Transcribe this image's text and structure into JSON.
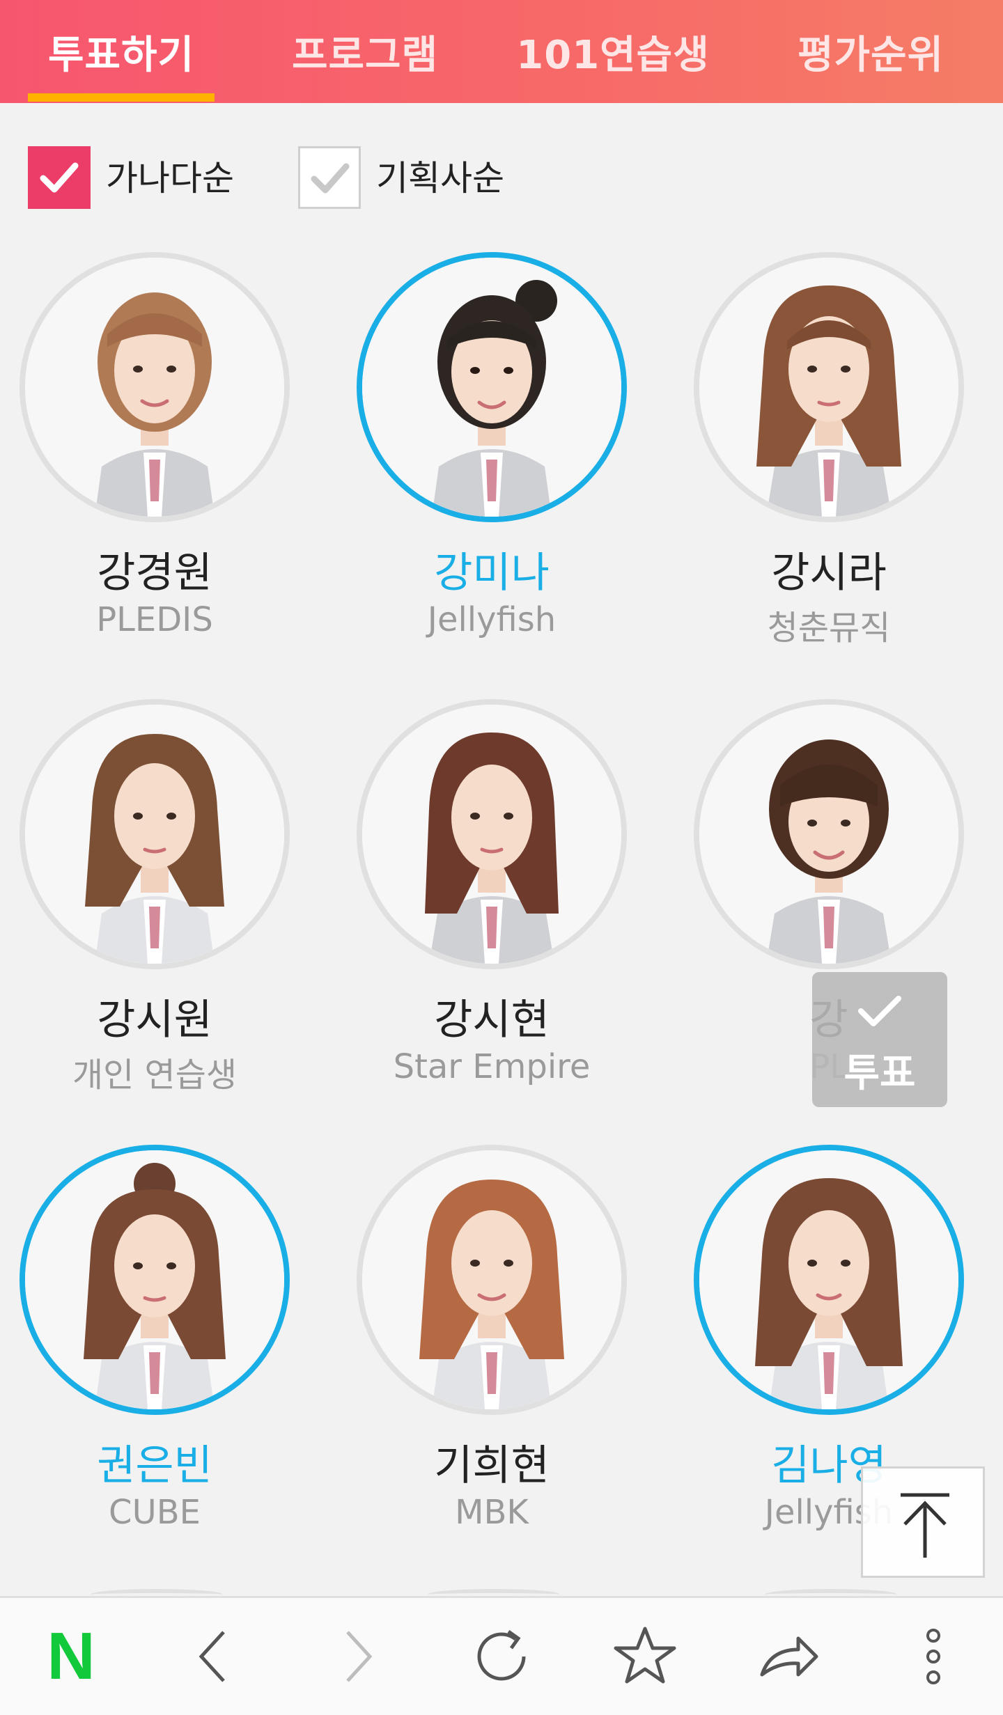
{
  "tabs": [
    {
      "label": "투표하기",
      "active": true
    },
    {
      "label": "프로그램",
      "active": false
    },
    {
      "label": "101연습생",
      "active": false
    },
    {
      "label": "평가순위",
      "active": false
    }
  ],
  "sort": [
    {
      "label": "가나다순",
      "checked": true
    },
    {
      "label": "기획사순",
      "checked": false
    }
  ],
  "trainees": [
    {
      "name": "강경원",
      "agency": "PLEDIS",
      "selected": false
    },
    {
      "name": "강미나",
      "agency": "Jellyfish",
      "selected": true
    },
    {
      "name": "강시라",
      "agency": "청춘뮤직",
      "selected": false
    },
    {
      "name": "강시원",
      "agency": "개인 연습생",
      "selected": false
    },
    {
      "name": "강시현",
      "agency": "Star Empire",
      "selected": false
    },
    {
      "name": "강",
      "agency": "PL",
      "selected": false
    },
    {
      "name": "권은빈",
      "agency": "CUBE",
      "selected": true
    },
    {
      "name": "기희현",
      "agency": "MBK",
      "selected": false
    },
    {
      "name": "김나영",
      "agency": "Jellyfish",
      "selected": true
    }
  ],
  "vote_button": {
    "label": "투표"
  },
  "bottom_nav": {
    "logo": "N"
  },
  "colors": {
    "header": "#f7566f",
    "accent_underline": "#ffb300",
    "checkbox_on": "#ec3d68",
    "selected": "#19aee6"
  }
}
